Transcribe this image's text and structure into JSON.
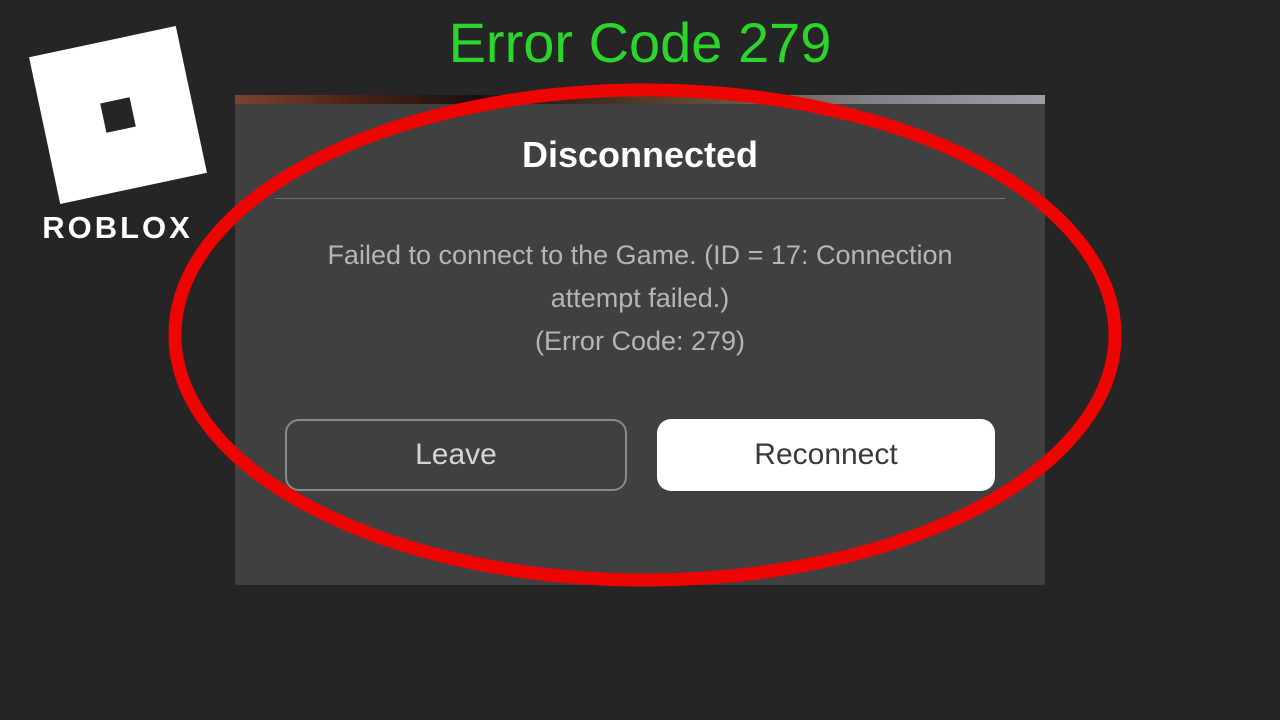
{
  "title": "Error Code 279",
  "logo_text": "ROBLOX",
  "dialog": {
    "title": "Disconnected",
    "message_line1": "Failed to connect to the Game. (ID = 17: Connection",
    "message_line2": "attempt failed.)",
    "message_line3": "(Error Code: 279)",
    "leave_label": "Leave",
    "reconnect_label": "Reconnect"
  },
  "colors": {
    "title_green": "#2bd52b",
    "annotation_red": "#ee0400"
  }
}
